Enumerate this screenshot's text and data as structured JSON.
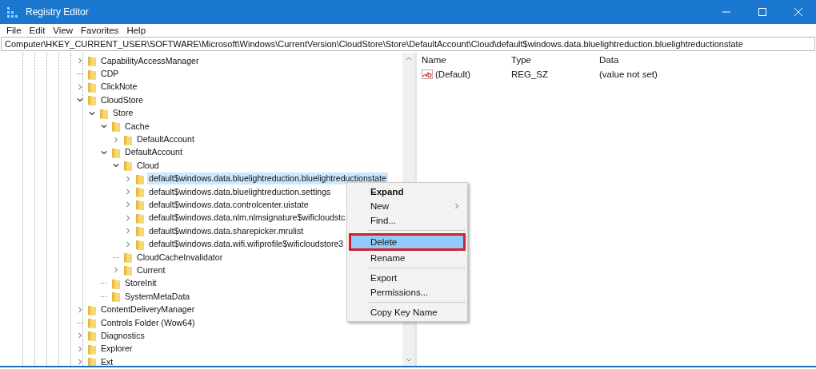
{
  "window": {
    "title": "Registry Editor"
  },
  "menu_bar": [
    "File",
    "Edit",
    "View",
    "Favorites",
    "Help"
  ],
  "address_bar": {
    "value": "Computer\\HKEY_CURRENT_USER\\SOFTWARE\\Microsoft\\Windows\\CurrentVersion\\CloudStore\\Store\\DefaultAccount\\Cloud\\default$windows.data.bluelightreduction.bluelightreductionstate"
  },
  "tree": [
    {
      "label": "CapabilityAccessManager",
      "expanded": false,
      "selected": false
    },
    {
      "label": "CDP",
      "selected": false
    },
    {
      "label": "ClickNote",
      "expanded": false,
      "selected": false
    },
    {
      "label": "CloudStore",
      "expanded": true,
      "selected": false,
      "children": [
        {
          "label": "Store",
          "expanded": true,
          "selected": false,
          "children": [
            {
              "label": "Cache",
              "expanded": true,
              "selected": false,
              "children": [
                {
                  "label": "DefaultAccount",
                  "expanded": false,
                  "selected": false
                }
              ]
            },
            {
              "label": "DefaultAccount",
              "expanded": true,
              "selected": false,
              "children": [
                {
                  "label": "Cloud",
                  "expanded": true,
                  "selected": false,
                  "children": [
                    {
                      "label": "default$windows.data.bluelightreduction.bluelightreductionstate",
                      "expanded": false,
                      "selected": true
                    },
                    {
                      "label": "default$windows.data.bluelightreduction.settings",
                      "expanded": false,
                      "selected": false
                    },
                    {
                      "label": "default$windows.data.controlcenter.uistate",
                      "expanded": false,
                      "selected": false
                    },
                    {
                      "label": "default$windows.data.nlm.nlmsignature$wificloudstc",
                      "expanded": false,
                      "selected": false
                    },
                    {
                      "label": "default$windows.data.sharepicker.mrulist",
                      "expanded": false,
                      "selected": false
                    },
                    {
                      "label": "default$windows.data.wifi.wifiprofile$wificloudstore3",
                      "expanded": false,
                      "selected": false
                    }
                  ]
                },
                {
                  "label": "CloudCacheInvalidator",
                  "selected": false
                },
                {
                  "label": "Current",
                  "expanded": false,
                  "selected": false
                }
              ]
            },
            {
              "label": "StoreInit",
              "selected": false
            },
            {
              "label": "SystemMetaData",
              "selected": false
            }
          ]
        }
      ]
    },
    {
      "label": "ContentDeliveryManager",
      "expanded": false,
      "selected": false
    },
    {
      "label": "Controls Folder (Wow64)",
      "selected": false
    },
    {
      "label": "Diagnostics",
      "expanded": false,
      "selected": false
    },
    {
      "label": "Explorer",
      "expanded": false,
      "selected": false
    },
    {
      "label": "Ext",
      "expanded": false,
      "selected": false
    }
  ],
  "values_table": {
    "columns": [
      "Name",
      "Type",
      "Data"
    ],
    "rows": [
      {
        "name": "(Default)",
        "type": "REG_SZ",
        "data": "(value not set)"
      }
    ]
  },
  "context_menu": [
    {
      "kind": "item",
      "label": "Expand",
      "bold": true,
      "submenu": false,
      "selected": false,
      "outlined": false
    },
    {
      "kind": "item",
      "label": "New",
      "bold": false,
      "submenu": true,
      "selected": false,
      "outlined": false
    },
    {
      "kind": "item",
      "label": "Find...",
      "bold": false,
      "submenu": false,
      "selected": false,
      "outlined": false
    },
    {
      "kind": "separator"
    },
    {
      "kind": "item",
      "label": "Delete",
      "bold": false,
      "submenu": false,
      "selected": true,
      "outlined": true
    },
    {
      "kind": "item",
      "label": "Rename",
      "bold": false,
      "submenu": false,
      "selected": false,
      "outlined": false
    },
    {
      "kind": "separator"
    },
    {
      "kind": "item",
      "label": "Export",
      "bold": false,
      "submenu": false,
      "selected": false,
      "outlined": false
    },
    {
      "kind": "item",
      "label": "Permissions...",
      "bold": false,
      "submenu": false,
      "selected": false,
      "outlined": false
    },
    {
      "kind": "separator"
    },
    {
      "kind": "item",
      "label": "Copy Key Name",
      "bold": false,
      "submenu": false,
      "selected": false,
      "outlined": false
    }
  ]
}
